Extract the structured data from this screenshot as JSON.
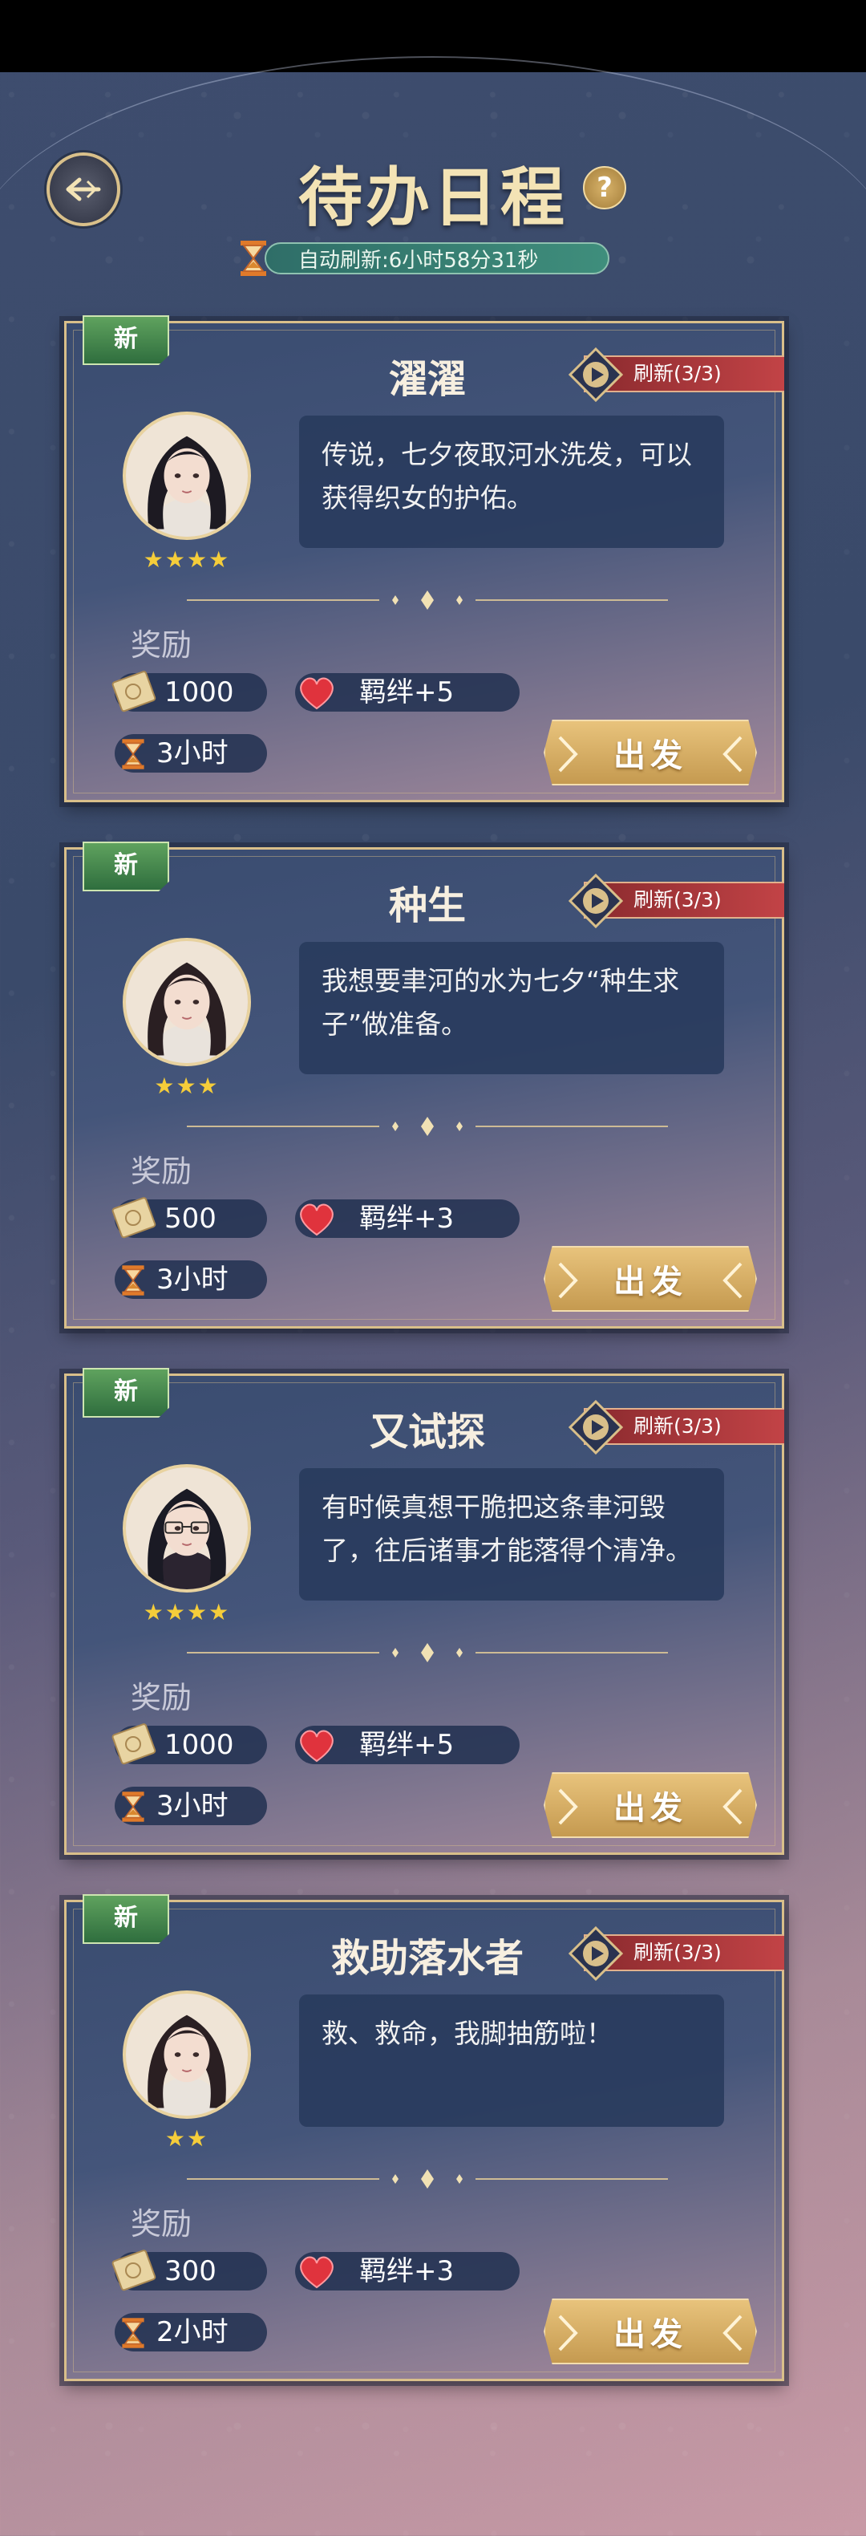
{
  "header": {
    "title": "待办日程",
    "help_label": "?",
    "timer_text": "自动刷新:6小时58分31秒"
  },
  "cards": [
    {
      "badge": "新",
      "title": "濯濯",
      "refresh": "刷新(3/3)",
      "dialogue": "传说，七夕夜取河水洗发，可以获得织女的护佑。",
      "stars": "★★★★",
      "reward_label": "奖励",
      "money": "1000",
      "bond": "羁绊+5",
      "duration": "3小时",
      "go_label": "出发"
    },
    {
      "badge": "新",
      "title": "种生",
      "refresh": "刷新(3/3)",
      "dialogue": "我想要聿河的水为七夕“种生求子”做准备。",
      "stars": "★★★",
      "reward_label": "奖励",
      "money": "500",
      "bond": "羁绊+3",
      "duration": "3小时",
      "go_label": "出发"
    },
    {
      "badge": "新",
      "title": "又试探",
      "refresh": "刷新(3/3)",
      "dialogue": "有时候真想干脆把这条聿河毁了，往后诸事才能落得个清净。",
      "stars": "★★★★",
      "reward_label": "奖励",
      "money": "1000",
      "bond": "羁绊+5",
      "duration": "3小时",
      "go_label": "出发"
    },
    {
      "badge": "新",
      "title": "救助落水者",
      "refresh": "刷新(3/3)",
      "dialogue": "救、救命，我脚抽筋啦！",
      "stars": "★★",
      "reward_label": "奖励",
      "money": "300",
      "bond": "羁绊+3",
      "duration": "2小时",
      "go_label": "出发"
    }
  ]
}
